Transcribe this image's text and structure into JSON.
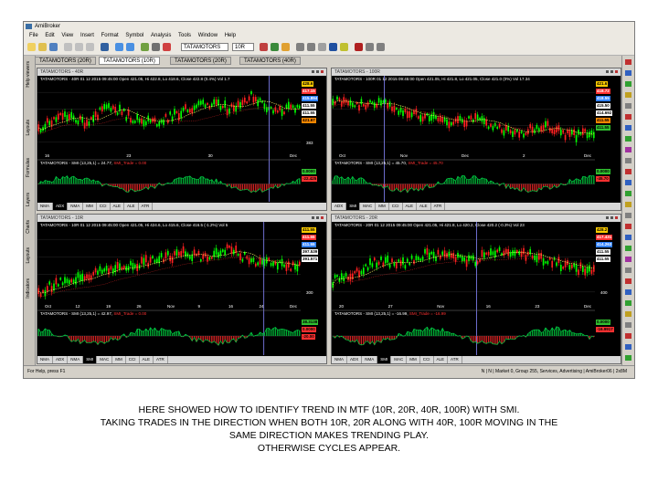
{
  "app": {
    "title": "AmiBroker",
    "menu": [
      "File",
      "Edit",
      "View",
      "Insert",
      "Format",
      "Symbol",
      "Analysis",
      "Tools",
      "Window",
      "Help"
    ],
    "symbol_value": "TATAMOTORS",
    "interval_value": "10R"
  },
  "tabs": [
    "TATAMOTORS (20R)",
    "TATAMOTORS (10R)",
    "TATAMOTORS (20R)",
    "TATAMOTORS (40R)"
  ],
  "side_labels": [
    "Help viewers",
    "Layouts",
    "Formulas",
    "Layers",
    "Charts",
    "Layouts",
    "Indicators"
  ],
  "panes": [
    {
      "window_title": "TATAMOTORS - 40R",
      "header": "TATAMOTORS - 40R 01 12 2015 09:45:00 Open 421.05, Hi 422.8, Lo 418.6, Close 422.8 (0.4%) Vol 1.7",
      "price_labels": [
        "428.6",
        "417.15",
        "415.894",
        "411.55",
        "411.55",
        "421.67"
      ],
      "x_labels": [
        "16",
        "23",
        "30",
        "Dec"
      ],
      "y_label": "383",
      "sub_header_prefix": "TATAMOTORS - SMI (13,25,1) = 24.77,",
      "sub_header_trade": "SMI_Trade = 0.00",
      "sub_values": [
        "0.0000",
        "-22.425"
      ],
      "sheet_tabs": [
        "NMA",
        "ADX",
        "NMA",
        "MM",
        "CCI",
        "ALE",
        "ALE",
        "ATR"
      ],
      "selected_tab": 1
    },
    {
      "window_title": "TATAMOTORS - 100R",
      "header": "TATAMOTORS - 100R 01 12 2015 09:45:00 Open 421.05, Hi 421.8, Lo 421.05, Close 421.0 (0%) Vol 17.34",
      "price_labels": [
        "421.6",
        "418.72",
        "418.55",
        "415.50",
        "414.692",
        "411.55",
        "411.55"
      ],
      "x_labels": [
        "Oct",
        "Nov",
        "Dec",
        "2",
        "Dec"
      ],
      "y_label": "",
      "sub_header_prefix": "TATAMOTORS - SMI (13,25,1) = 45.70,",
      "sub_header_trade": "SMI_Trade = 45.70",
      "sub_values": [
        "0.0000",
        "-45.70"
      ],
      "sheet_tabs": [
        "ADX",
        "SMI",
        "MAC",
        "MM",
        "CCI",
        "ALE",
        "ALE",
        "ATR"
      ],
      "selected_tab": 1
    },
    {
      "window_title": "TATAMOTORS - 10R",
      "header": "TATAMOTORS - 10R 01 12 2015 09:45:00 Open 421.05, Hi 424.6, Lo 415.6, Close 416.5 (-1.2%) Vol 5",
      "price_labels": [
        "411.55",
        "411.55",
        "411.55",
        "397.539",
        "391.571"
      ],
      "x_labels": [
        "Oct",
        "12",
        "19",
        "26",
        "Nov",
        "9",
        "16",
        "24",
        "Dec"
      ],
      "y_label": "300",
      "sub_header_prefix": "TATAMOTORS - SMI (13,25,1) = 42.97,",
      "sub_header_trade": "SMI_Trade = 0.00",
      "sub_values": [
        "38.3138",
        "0.0000",
        "-20.00"
      ],
      "sheet_tabs": [
        "NMA",
        "ADX",
        "NMA",
        "SMI",
        "MAC",
        "MM",
        "CCI",
        "ALE",
        "ATR"
      ],
      "selected_tab": 3
    },
    {
      "window_title": "TATAMOTORS - 20R",
      "header": "TATAMOTORS - 20R 01 12 2015 09:45:00 Open 421.05, Hi 421.8, Lo 420.2, Close 420.2 (-0.3%) Vol 23",
      "price_labels": [
        "428.2",
        "417.431",
        "414.263",
        "411.55",
        "411.55"
      ],
      "x_labels": [
        "20",
        "27",
        "Nov",
        "16",
        "23",
        "Dec"
      ],
      "y_label": "400",
      "sub_header_prefix": "TATAMOTORS - SMI (13,25,1) = -16.99,",
      "sub_header_trade": "SMI_Trade = -16.99",
      "sub_values": [
        "0.0000",
        "-16.9917"
      ],
      "sheet_tabs": [
        "NMA",
        "ADX",
        "NMA",
        "SMI",
        "MAC",
        "MM",
        "CCI",
        "ALE",
        "ATR"
      ],
      "selected_tab": 3
    }
  ],
  "status": {
    "left": "For Help, press F1",
    "right": "N | N | Market 0, Group 255, Services, Advertising | AmiBroker06 | 2x8M"
  },
  "caption": [
    "HERE SHOWED HOW TO IDENTIFY TREND IN MTF (10R, 20R, 40R, 100R) WITH SMI.",
    "TAKING TRADES IN THE DIRECTION WHEN BOTH 10R, 20R ALONG WITH 40R, 100R MOVING IN THE",
    "SAME DIRECTION MAKES TRENDING PLAY.",
    "OTHERWISE CYCLES APPEAR."
  ],
  "colors": {
    "up_candle": "#00ff00",
    "down_candle": "#ff2020",
    "ma_line": "#ffff66",
    "smi_line": "#00cc44"
  }
}
